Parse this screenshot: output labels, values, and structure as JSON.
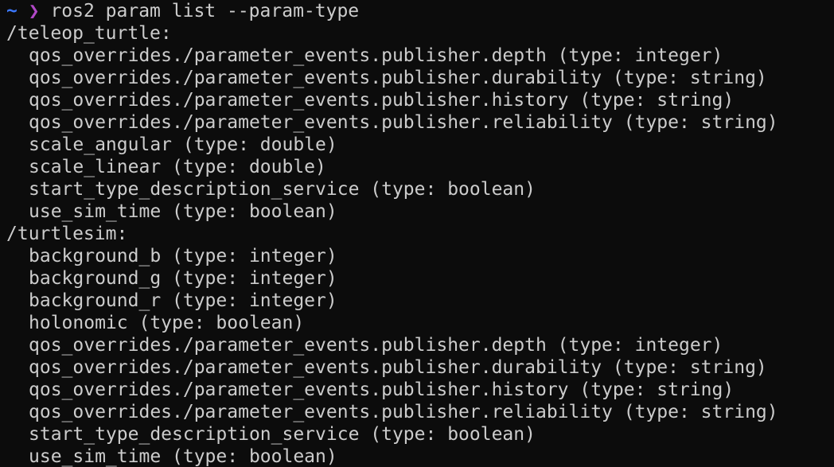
{
  "prompt": {
    "cwd": "~",
    "symbol": "❯",
    "command": "ros2 param list --param-type"
  },
  "output": {
    "teleop_turtle": {
      "node": "/teleop_turtle:",
      "params": [
        "qos_overrides./parameter_events.publisher.depth (type: integer)",
        "qos_overrides./parameter_events.publisher.durability (type: string)",
        "qos_overrides./parameter_events.publisher.history (type: string)",
        "qos_overrides./parameter_events.publisher.reliability (type: string)",
        "scale_angular (type: double)",
        "scale_linear (type: double)",
        "start_type_description_service (type: boolean)",
        "use_sim_time (type: boolean)"
      ]
    },
    "turtlesim": {
      "node": "/turtlesim:",
      "params": [
        "background_b (type: integer)",
        "background_g (type: integer)",
        "background_r (type: integer)",
        "holonomic (type: boolean)",
        "qos_overrides./parameter_events.publisher.depth (type: integer)",
        "qos_overrides./parameter_events.publisher.durability (type: string)",
        "qos_overrides./parameter_events.publisher.history (type: string)",
        "qos_overrides./parameter_events.publisher.reliability (type: string)",
        "start_type_description_service (type: boolean)",
        "use_sim_time (type: boolean)"
      ]
    }
  }
}
